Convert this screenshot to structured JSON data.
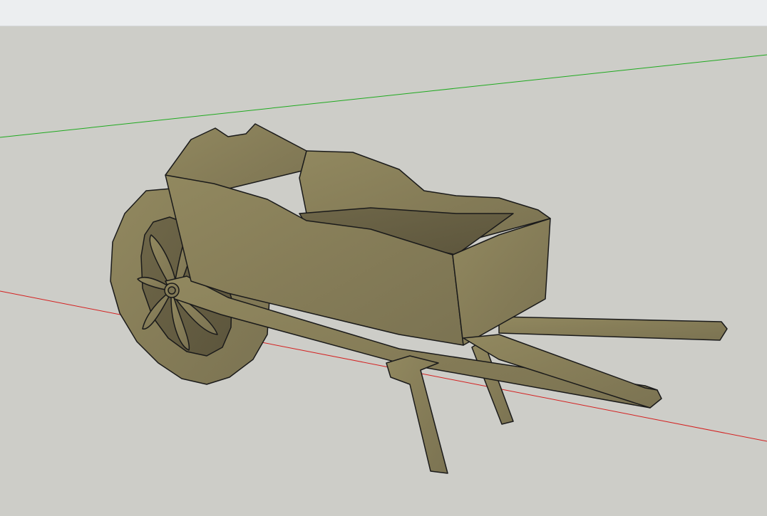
{
  "app": {
    "toolbar": {},
    "viewport": {
      "background_color": "#cdcdc8",
      "axes": {
        "green_axis_color": "#1faa1f",
        "red_axis_color": "#d42020"
      },
      "model": {
        "object": "wheelbarrow",
        "material_color": "#8d8462",
        "edge_color": "#1a1a1a"
      }
    }
  }
}
